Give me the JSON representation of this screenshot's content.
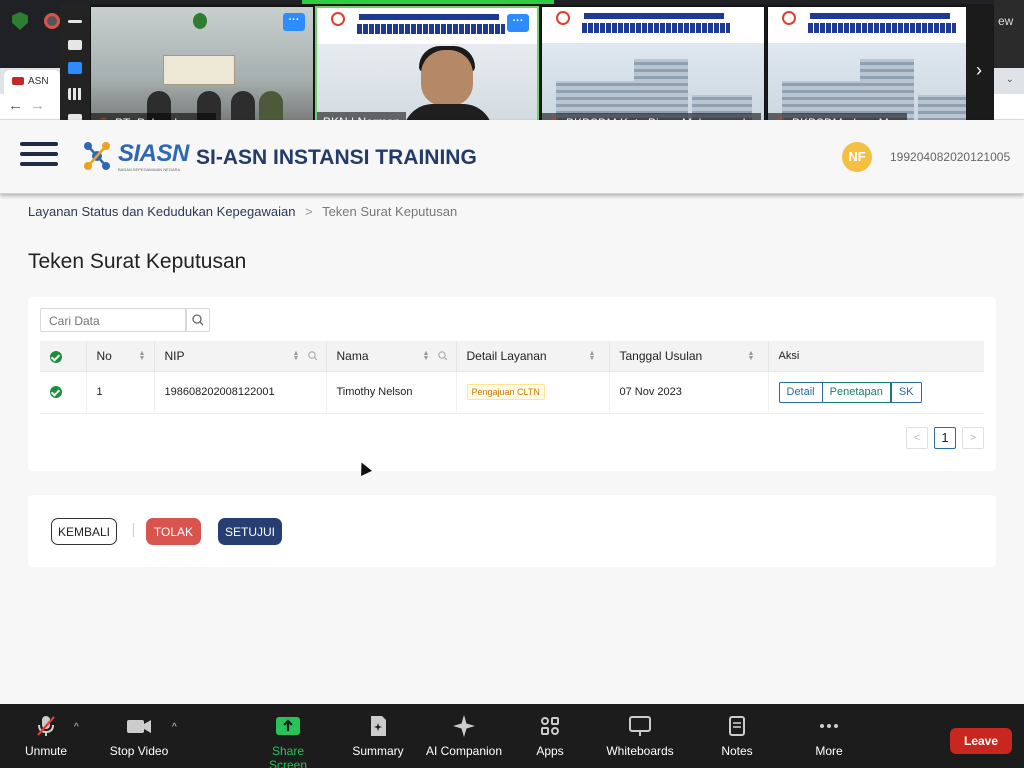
{
  "browser": {
    "tab_label": "ASN",
    "right_text": "ew"
  },
  "zoom_strip": {
    "tiles": [
      {
        "name": "PT_Palangkaraya"
      },
      {
        "name": "BKN | Norman"
      },
      {
        "name": "BKPSDM Kota Bima_Muhammad..."
      },
      {
        "name": "BKPSDM_dayu Mas"
      }
    ]
  },
  "header": {
    "logo_text": "SIASN",
    "logo_sub": "BADAN KEPEGAWAIAN NEGARA",
    "title": "SI-ASN INSTANSI TRAINING",
    "avatar_initials": "NF",
    "user_id": "199204082020121005"
  },
  "breadcrumb": {
    "parent": "Layanan Status dan Kedudukan Kepegawaian",
    "separator": ">",
    "current": "Teken Surat Keputusan"
  },
  "page_title": "Teken Surat Keputusan",
  "search": {
    "placeholder": "Cari Data"
  },
  "table": {
    "columns": {
      "no": "No",
      "nip": "NIP",
      "nama": "Nama",
      "detail": "Detail Layanan",
      "tanggal": "Tanggal Usulan",
      "aksi": "Aksi"
    },
    "rows": [
      {
        "no": "1",
        "nip": "198608202008122001",
        "nama": "Timothy Nelson",
        "detail": "Pengajuan CLTN",
        "tanggal": "07 Nov 2023",
        "actions": [
          "Detail",
          "Penetapan",
          "SK"
        ]
      }
    ]
  },
  "pagination": {
    "prev": "<",
    "current": "1",
    "next": ">"
  },
  "actions": {
    "back": "KEMBALI",
    "reject": "TOLAK",
    "approve": "SETUJUI"
  },
  "zoom_toolbar": {
    "unmute": "Unmute",
    "stop_video": "Stop Video",
    "share_screen": "Share Screen",
    "summary": "Summary",
    "ai_companion": "AI Companion",
    "apps": "Apps",
    "whiteboards": "Whiteboards",
    "notes": "Notes",
    "more": "More",
    "leave": "Leave"
  },
  "colors": {
    "brand_navy": "#233b69",
    "approve": "#273e72",
    "reject": "#d9534f",
    "avatar": "#f5bf42",
    "share_green": "#27c45a",
    "leave_red": "#c7271e"
  }
}
